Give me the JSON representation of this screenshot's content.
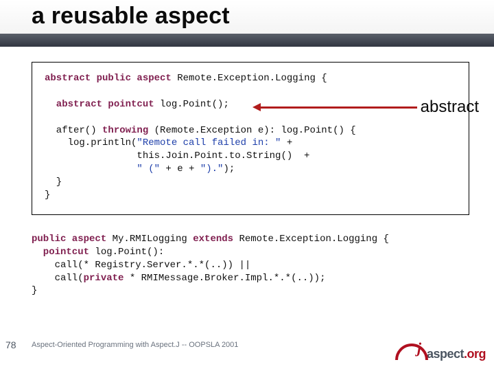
{
  "title": "a reusable aspect",
  "callout": "abstract",
  "box": {
    "l1_pre": "abstract public aspect",
    "l1_name": " Remote.Exception.Logging {",
    "l2_pre": "  abstract pointcut",
    "l2_rest": " log.Point();",
    "l3a": "  after() ",
    "l3b": "throwing",
    "l3c": " (Remote.Exception e): log.Point() {",
    "l4a": "    log.println(",
    "l4b": "\"Remote call failed in: \"",
    "l4c": " +",
    "l5": "                this.Join.Point.to.String()  +",
    "l6a": "                ",
    "l6b": "\" (\"",
    "l6c": " + e + ",
    "l6d": "\").\"",
    "l6e": ");",
    "l7": "  }",
    "l8": "}"
  },
  "free": {
    "l1a": "public aspect",
    "l1b": " My.RMILogging ",
    "l1c": "extends",
    "l1d": " Remote.Exception.Logging {",
    "l2a": "  pointcut",
    "l2b": " log.Point():",
    "l3": "    call(* Registry.Server.*.*(..)) ||",
    "l4a": "    call(",
    "l4b": "private",
    "l4c": " * RMIMessage.Broker.Impl.*.*(..));",
    "l5": "}"
  },
  "footer": {
    "page": "78",
    "text": "Aspect-Oriented Programming with Aspect.J -- OOPSLA 2001"
  },
  "logo": {
    "word_a": "aspect",
    "word_b": ".org"
  }
}
